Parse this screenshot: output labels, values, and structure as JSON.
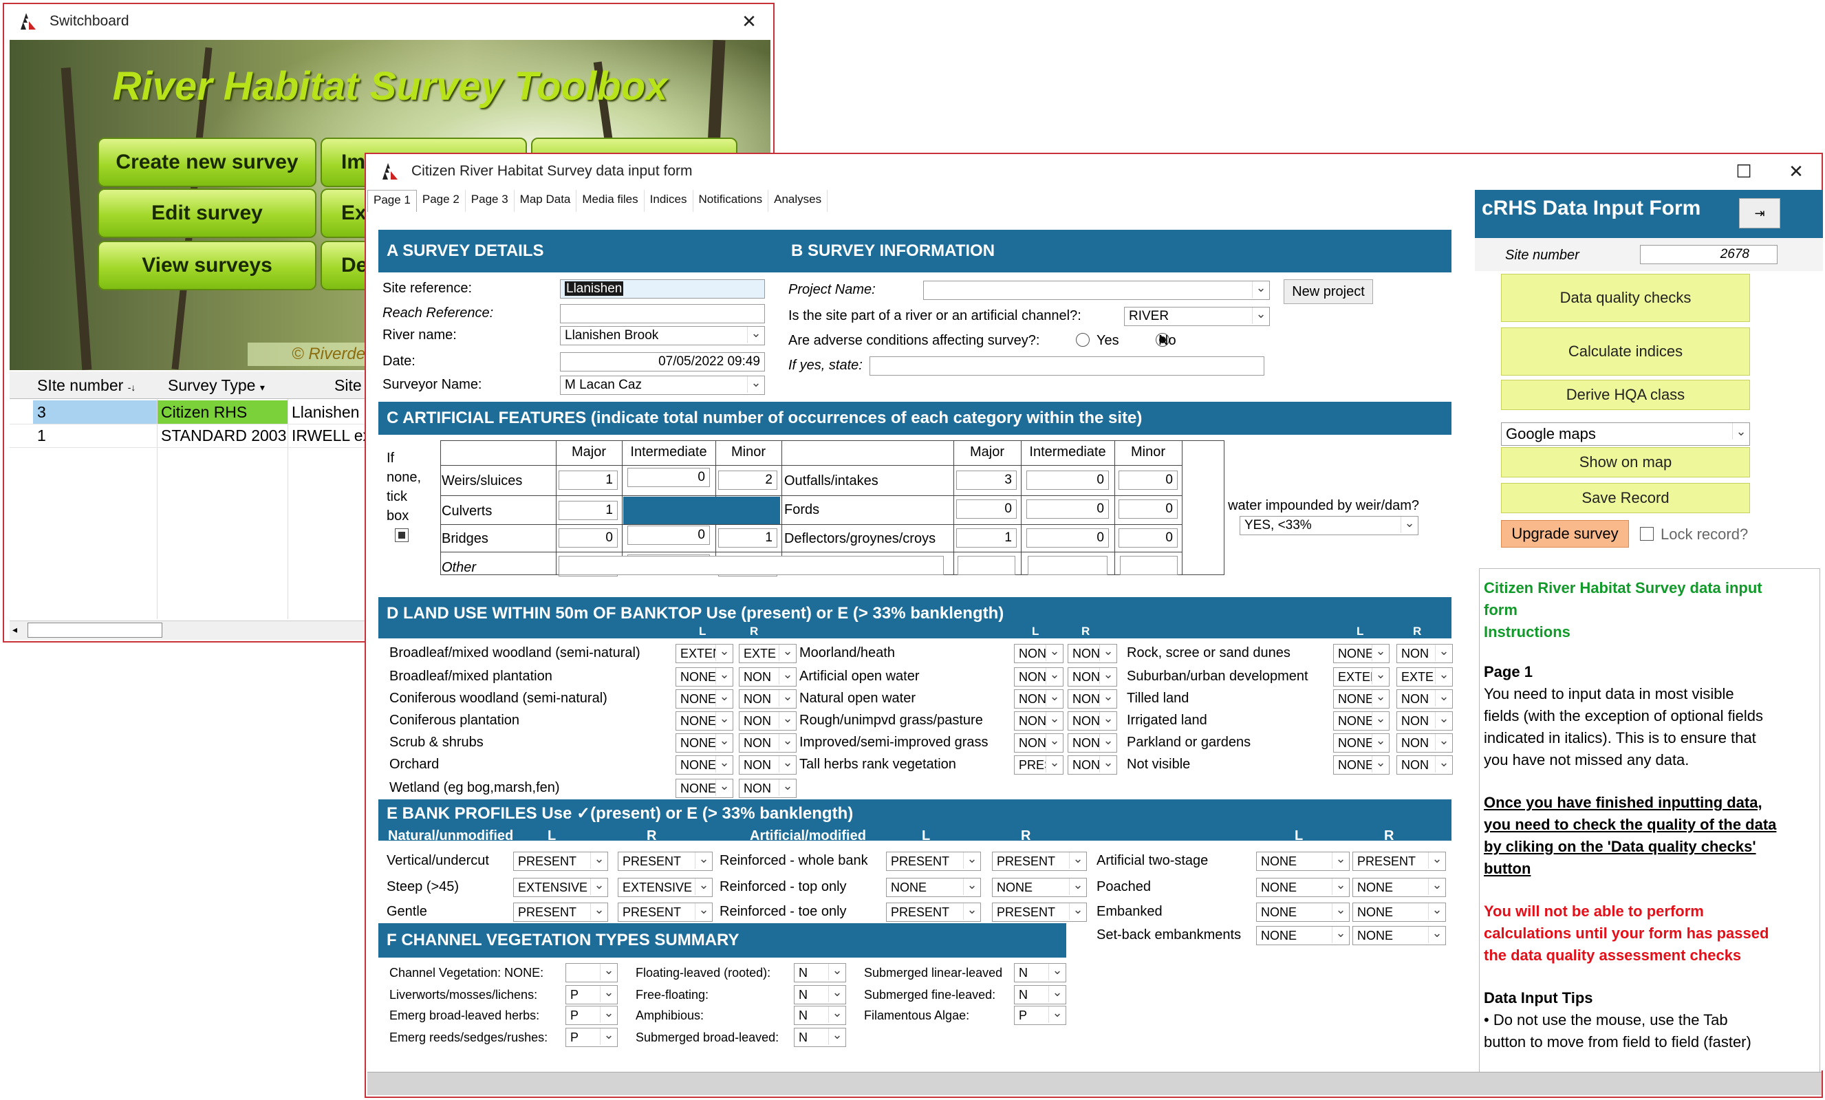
{
  "switchboard": {
    "title": "Switchboard",
    "hero_title": "River Habitat Survey Toolbox",
    "buttons": [
      "Create new survey",
      "Edit  survey",
      "View surveys"
    ],
    "partial_buttons": [
      "Im",
      "Ex",
      "De"
    ],
    "copyright": "© Riverde",
    "columns": [
      "SIte number",
      "Survey Type",
      "Site"
    ],
    "rows": [
      [
        "3",
        "Citizen RHS",
        "Llanishen"
      ],
      [
        "1",
        "STANDARD 2003",
        "IRWELL ex"
      ]
    ]
  },
  "form": {
    "title": "Citizen River Habitat Survey data input form",
    "tabs": [
      "Page 1",
      "Page 2",
      "Page 3",
      "Map Data",
      "Media files",
      "Indices",
      "Notifications",
      "Analyses"
    ],
    "secA": "A  SURVEY DETAILS",
    "secB": "B  SURVEY INFORMATION",
    "site_ref_label": "Site reference:",
    "site_ref": "Llanishen",
    "reach_label": "Reach Reference:",
    "reach": "",
    "river_label": "River name:",
    "river": "Llanishen Brook",
    "date_label": "Date:",
    "date": "07/05/2022 09:49",
    "surveyor_label": "Surveyor Name:",
    "surveyor": "M Lacan Caz",
    "project_label": "Project Name:",
    "project": "",
    "new_project": "New project",
    "channel_label": "Is the site part of a river or an artificial channel?:",
    "channel": "RIVER",
    "adverse_label": "Are adverse conditions affecting survey?:",
    "yes": "Yes",
    "no": "No",
    "ifyes_label": "If yes, state:",
    "ifyes": "",
    "secC": "C  ARTIFICIAL FEATURES (indicate total number of occurrences of each category within the site)",
    "if_none": [
      "If",
      "none,",
      "tick",
      "box"
    ],
    "col_major": "Major",
    "col_intermediate": "Intermediate",
    "col_minor": "Minor",
    "c_left": [
      {
        "label": "Weirs/sluices",
        "major": "1",
        "inter": "0",
        "minor": "2"
      },
      {
        "label": "Culverts",
        "major": "1",
        "inter": "",
        "minor": ""
      },
      {
        "label": "Bridges",
        "major": "0",
        "inter": "0",
        "minor": "1"
      },
      {
        "label": "Other",
        "major": "",
        "inter": "",
        "minor": ""
      }
    ],
    "c_right": [
      {
        "label": "Outfalls/intakes",
        "major": "3",
        "inter": "0",
        "minor": "0"
      },
      {
        "label": "Fords",
        "major": "0",
        "inter": "0",
        "minor": "0"
      },
      {
        "label": "Deflectors/groynes/croys",
        "major": "1",
        "inter": "0",
        "minor": "0"
      }
    ],
    "impound_label": "Is water impounded by weir/dam?",
    "impound": "YES, <33%",
    "secD": "D  LAND USE WITHIN 50m OF BANKTOP  Use     (present) or E (> 33% banklength)",
    "L": "L",
    "R": "R",
    "d_col1": [
      [
        "Broadleaf/mixed woodland (semi-natural)",
        "EXTEN",
        "EXTE"
      ],
      [
        "Broadleaf/mixed plantation",
        "NONE",
        "NON"
      ],
      [
        "Coniferous woodland (semi-natural)",
        "NONE",
        "NON"
      ],
      [
        "Coniferous plantation",
        "NONE",
        "NON"
      ],
      [
        "Scrub & shrubs",
        "NONE",
        "NON"
      ],
      [
        "Orchard",
        "NONE",
        "NON"
      ],
      [
        "Wetland (eg bog,marsh,fen)",
        "NONE",
        "NON"
      ]
    ],
    "d_col2": [
      [
        "Moorland/heath",
        "NON",
        "NON"
      ],
      [
        "Artificial open water",
        "NON",
        "NON"
      ],
      [
        "Natural open water",
        "NON",
        "NON"
      ],
      [
        "Rough/unimpvd grass/pasture",
        "NON",
        "NON"
      ],
      [
        "Improved/semi-improved grass",
        "NON",
        "NON"
      ],
      [
        "Tall herbs rank vegetation",
        "PRES",
        "NON"
      ]
    ],
    "d_col3": [
      [
        "Rock, scree or sand dunes",
        "NONE",
        "NON"
      ],
      [
        "Suburban/urban development",
        "EXTEN",
        "EXTE"
      ],
      [
        "Tilled land",
        "NONE",
        "NON"
      ],
      [
        "Irrigated land",
        "NONE",
        "NON"
      ],
      [
        "Parkland or gardens",
        "NONE",
        "NON"
      ],
      [
        "Not visible",
        "NONE",
        "NON"
      ]
    ],
    "secE": "E  BANK PROFILES  Use  ✓(present) or E (> 33% banklength)",
    "e_natural": "Natural/unmodified",
    "e_artificial": "Artificial/modified",
    "e_col1": [
      [
        "Vertical/undercut",
        "PRESENT",
        "PRESENT"
      ],
      [
        "Steep (>45)",
        "EXTENSIVE",
        "EXTENSIVE"
      ],
      [
        "Gentle",
        "PRESENT",
        "PRESENT"
      ]
    ],
    "e_col2": [
      [
        "Reinforced - whole bank",
        "PRESENT",
        "PRESENT"
      ],
      [
        "Reinforced - top only",
        "NONE",
        "NONE"
      ],
      [
        "Reinforced - toe only",
        "PRESENT",
        "PRESENT"
      ]
    ],
    "e_col3": [
      [
        "Artificial two-stage",
        "NONE",
        "PRESENT"
      ],
      [
        "Poached",
        "NONE",
        "NONE"
      ],
      [
        "Embanked",
        "NONE",
        "NONE"
      ],
      [
        "Set-back embankments",
        "NONE",
        "NONE"
      ]
    ],
    "secF": "F CHANNEL VEGETATION TYPES SUMMARY",
    "f_col1": [
      [
        "Channel Vegetation: NONE:",
        ""
      ],
      [
        "Liverworts/mosses/lichens:",
        "P"
      ],
      [
        "Emerg broad-leaved herbs:",
        "P"
      ],
      [
        "Emerg reeds/sedges/rushes:",
        "P"
      ]
    ],
    "f_col2": [
      [
        "Floating-leaved (rooted):",
        "N"
      ],
      [
        "Free-floating:",
        "N"
      ],
      [
        "Amphibious:",
        "N"
      ],
      [
        "Submerged broad-leaved:",
        "N"
      ]
    ],
    "f_col3": [
      [
        "Submerged linear-leaved",
        "N"
      ],
      [
        "Submerged fine-leaved:",
        "N"
      ],
      [
        "Filamentous Algae:",
        "P"
      ]
    ]
  },
  "side": {
    "title": "cRHS Data Input Form",
    "site_number_label": "Site number",
    "site_number": "2678",
    "btn_quality": "Data quality checks",
    "btn_indices": "Calculate indices",
    "btn_hqa": "Derive HQA class",
    "map_select": "Google maps",
    "btn_show": "Show on map",
    "btn_save": "Save Record",
    "btn_upgrade": "Upgrade survey",
    "lock_label": "Lock record?",
    "instr_title1": "Citizen River Habitat Survey data input",
    "instr_title2": "form",
    "instr_title3": "Instructions",
    "page1": "Page 1",
    "p1": [
      "You need to input data in most visible",
      "fields (with the exception of optional fields",
      "indicated in italics). This is to ensure that",
      "you have not missed any data."
    ],
    "u": [
      "Once you have finished inputting data,",
      "you need to check the quality of the data",
      "by cliking on the 'Data quality checks'",
      "button"
    ],
    "r": [
      "You will not be able to perform",
      "calculations until your form has passed",
      "the data quality assessment checks"
    ],
    "tips_title": "Data Input Tips",
    "tips": [
      "• Do not use the mouse, use the Tab",
      "button to move from field to field (faster)"
    ]
  },
  "colors": {
    "section": "#1e6d99",
    "accent_green": "#119a2a",
    "warning_red": "#e3101a",
    "yellow_btn": "#eef79a",
    "upgrade": "#f9b98a"
  }
}
